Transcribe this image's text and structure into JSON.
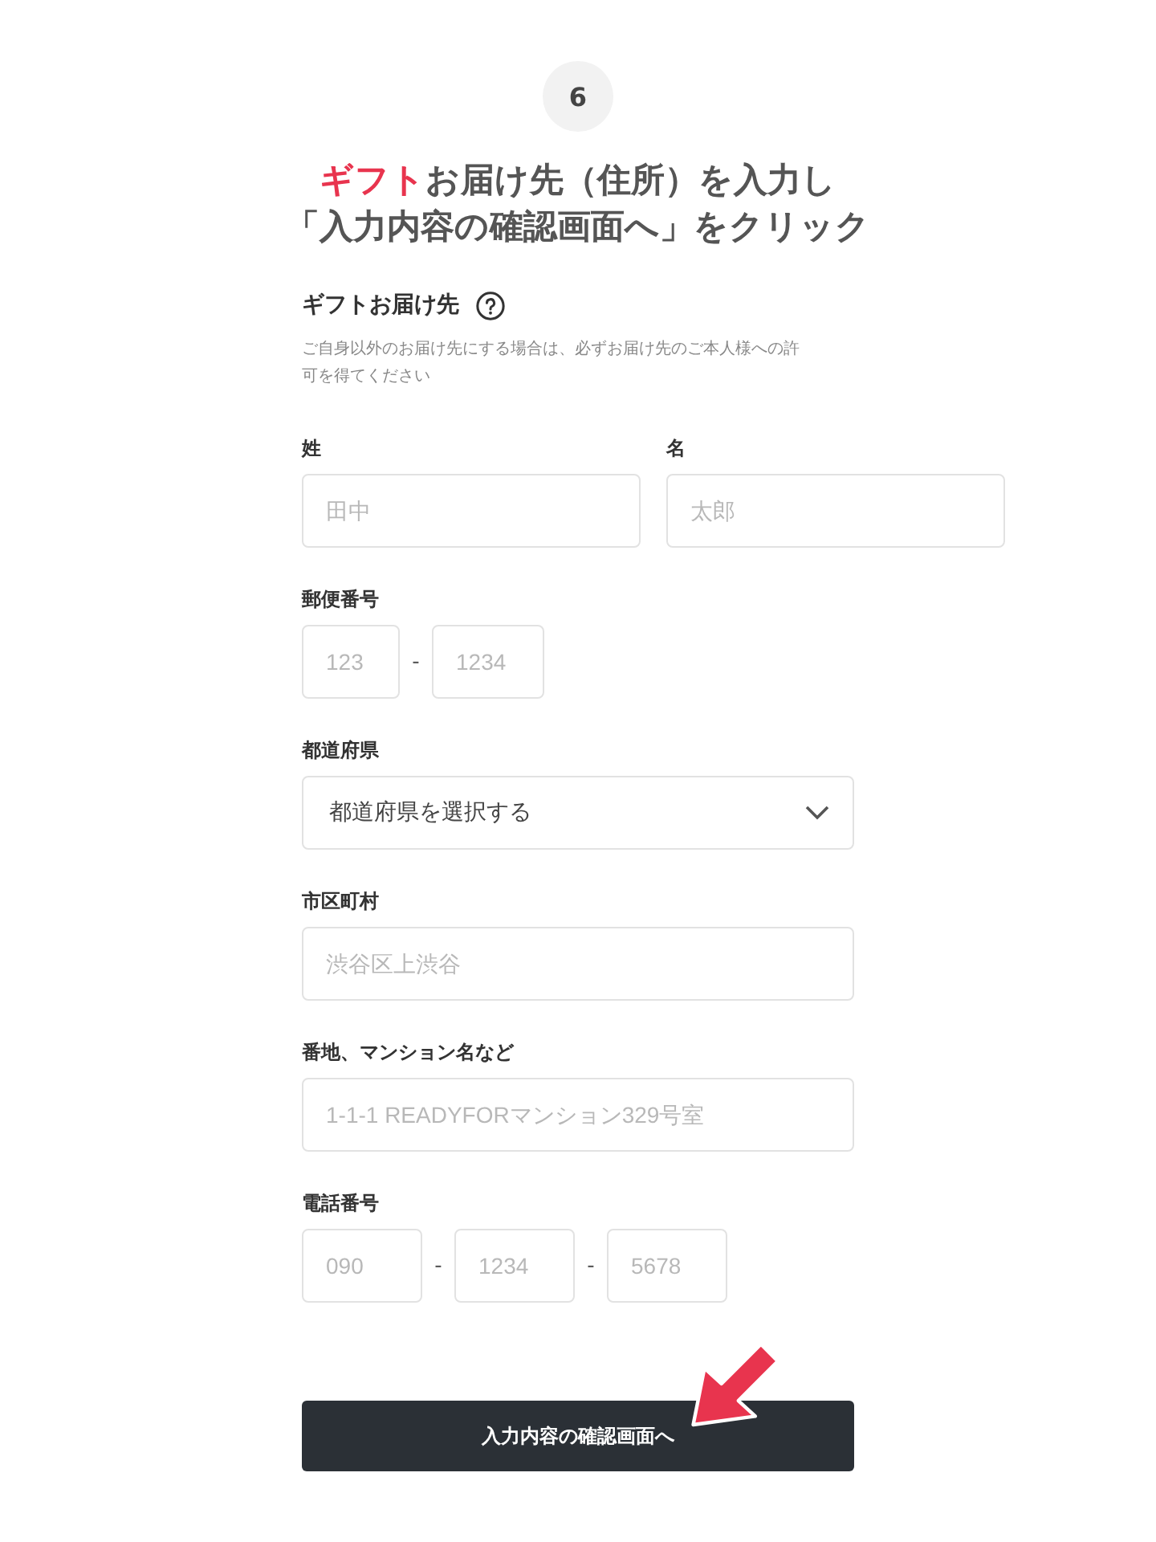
{
  "step": "6",
  "title_lines": [
    [
      {
        "text": "ギフト",
        "highlight": true
      },
      {
        "text": "お届け先（住所）を入力し",
        "highlight": false
      }
    ],
    [
      {
        "text": "「入力内容の確認画面へ」をクリック",
        "highlight": false
      }
    ]
  ],
  "section": {
    "title": "ギフトお届け先",
    "note": "ご自身以外のお届け先にする場合は、必ずお届け先のご本人様への許可を得てください"
  },
  "fields": [
    {
      "kind": "pair",
      "items": [
        {
          "label": "姓",
          "placeholder": "田中"
        },
        {
          "label": "名",
          "placeholder": "太郎"
        }
      ]
    },
    {
      "kind": "segments",
      "label": "郵便番号",
      "separator": "-",
      "placeholders": [
        "123",
        "1234"
      ]
    },
    {
      "kind": "select",
      "label": "都道府県",
      "value": "都道府県を選択する"
    },
    {
      "kind": "single",
      "label": "市区町村",
      "placeholder": "渋谷区上渋谷"
    },
    {
      "kind": "single",
      "label": "番地、マンション名など",
      "placeholder": "1-1-1 READYFORマンション329号室"
    },
    {
      "kind": "segments",
      "label": "電話番号",
      "separator": "-",
      "placeholders": [
        "090",
        "1234",
        "5678"
      ]
    }
  ],
  "button": {
    "label": "入力内容の確認画面へ"
  },
  "annotation": {
    "kind": "arrow"
  }
}
